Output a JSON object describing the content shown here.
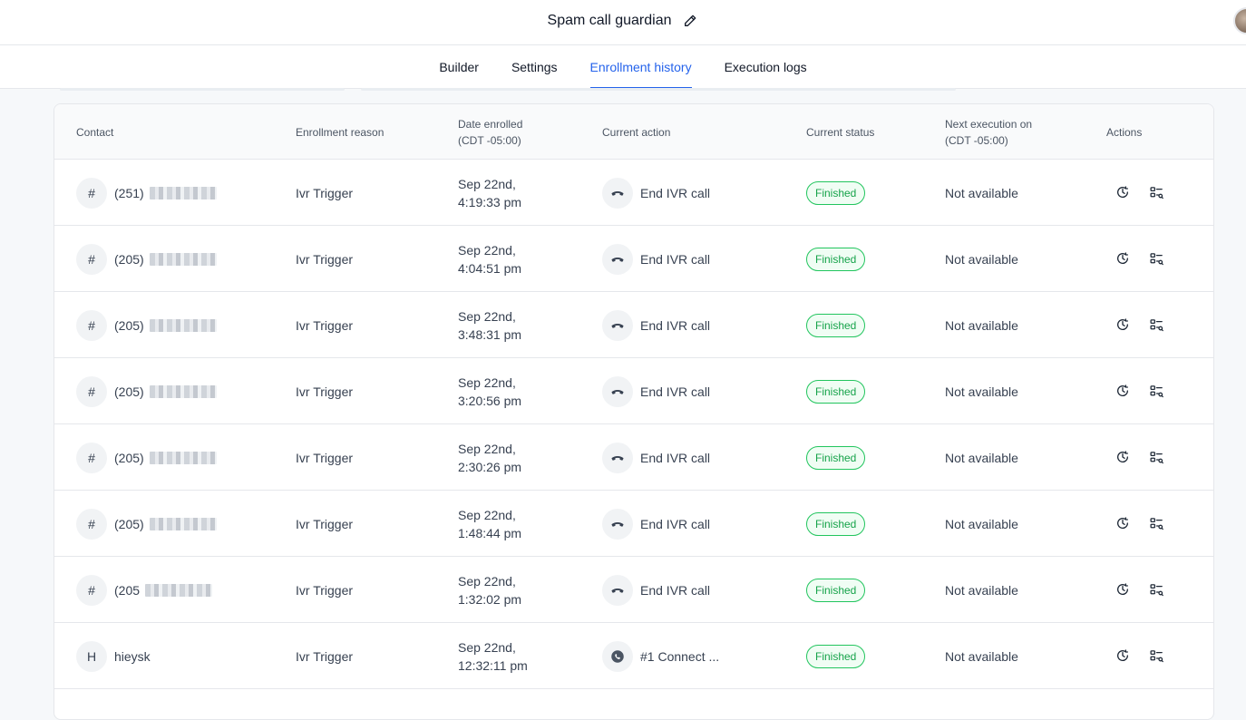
{
  "header": {
    "title": "Spam call guardian"
  },
  "tabs": [
    {
      "label": "Builder",
      "active": false
    },
    {
      "label": "Settings",
      "active": false
    },
    {
      "label": "Enrollment history",
      "active": true
    },
    {
      "label": "Execution logs",
      "active": false
    }
  ],
  "table": {
    "columns": {
      "contact": "Contact",
      "reason": "Enrollment reason",
      "date_line1": "Date enrolled",
      "date_line2": "(CDT -05:00)",
      "action": "Current action",
      "status": "Current status",
      "next_line1": "Next execution on",
      "next_line2": "(CDT -05:00)",
      "actions": "Actions"
    },
    "rows": [
      {
        "badge": "#",
        "contact": "(251)",
        "reason": "Ivr Trigger",
        "date1": "Sep 22nd,",
        "date2": "4:19:33 pm",
        "action_icon": "phone-hangup-icon",
        "action": "End IVR call",
        "status": "Finished",
        "next": "Not available"
      },
      {
        "badge": "#",
        "contact": "(205)",
        "reason": "Ivr Trigger",
        "date1": "Sep 22nd,",
        "date2": "4:04:51 pm",
        "action_icon": "phone-hangup-icon",
        "action": "End IVR call",
        "status": "Finished",
        "next": "Not available"
      },
      {
        "badge": "#",
        "contact": "(205)",
        "reason": "Ivr Trigger",
        "date1": "Sep 22nd,",
        "date2": "3:48:31 pm",
        "action_icon": "phone-hangup-icon",
        "action": "End IVR call",
        "status": "Finished",
        "next": "Not available"
      },
      {
        "badge": "#",
        "contact": "(205)",
        "reason": "Ivr Trigger",
        "date1": "Sep 22nd,",
        "date2": "3:20:56 pm",
        "action_icon": "phone-hangup-icon",
        "action": "End IVR call",
        "status": "Finished",
        "next": "Not available"
      },
      {
        "badge": "#",
        "contact": "(205)",
        "reason": "Ivr Trigger",
        "date1": "Sep 22nd,",
        "date2": "2:30:26 pm",
        "action_icon": "phone-hangup-icon",
        "action": "End IVR call",
        "status": "Finished",
        "next": "Not available"
      },
      {
        "badge": "#",
        "contact": "(205)",
        "reason": "Ivr Trigger",
        "date1": "Sep 22nd,",
        "date2": "1:48:44 pm",
        "action_icon": "phone-hangup-icon",
        "action": "End IVR call",
        "status": "Finished",
        "next": "Not available"
      },
      {
        "badge": "#",
        "contact": "(205",
        "reason": "Ivr Trigger",
        "date1": "Sep 22nd,",
        "date2": "1:32:02 pm",
        "action_icon": "phone-hangup-icon",
        "action": "End IVR call",
        "status": "Finished",
        "next": "Not available"
      },
      {
        "badge": "H",
        "contact": "hieysk",
        "reason": "Ivr Trigger",
        "date1": "Sep 22nd,",
        "date2": "12:32:11 pm",
        "action_icon": "phone-connect-icon",
        "action": "#1 Connect ...",
        "status": "Finished",
        "next": "Not available",
        "plain": true
      }
    ]
  },
  "colors": {
    "accent": "#2563eb",
    "status_green": "#16a34a"
  }
}
